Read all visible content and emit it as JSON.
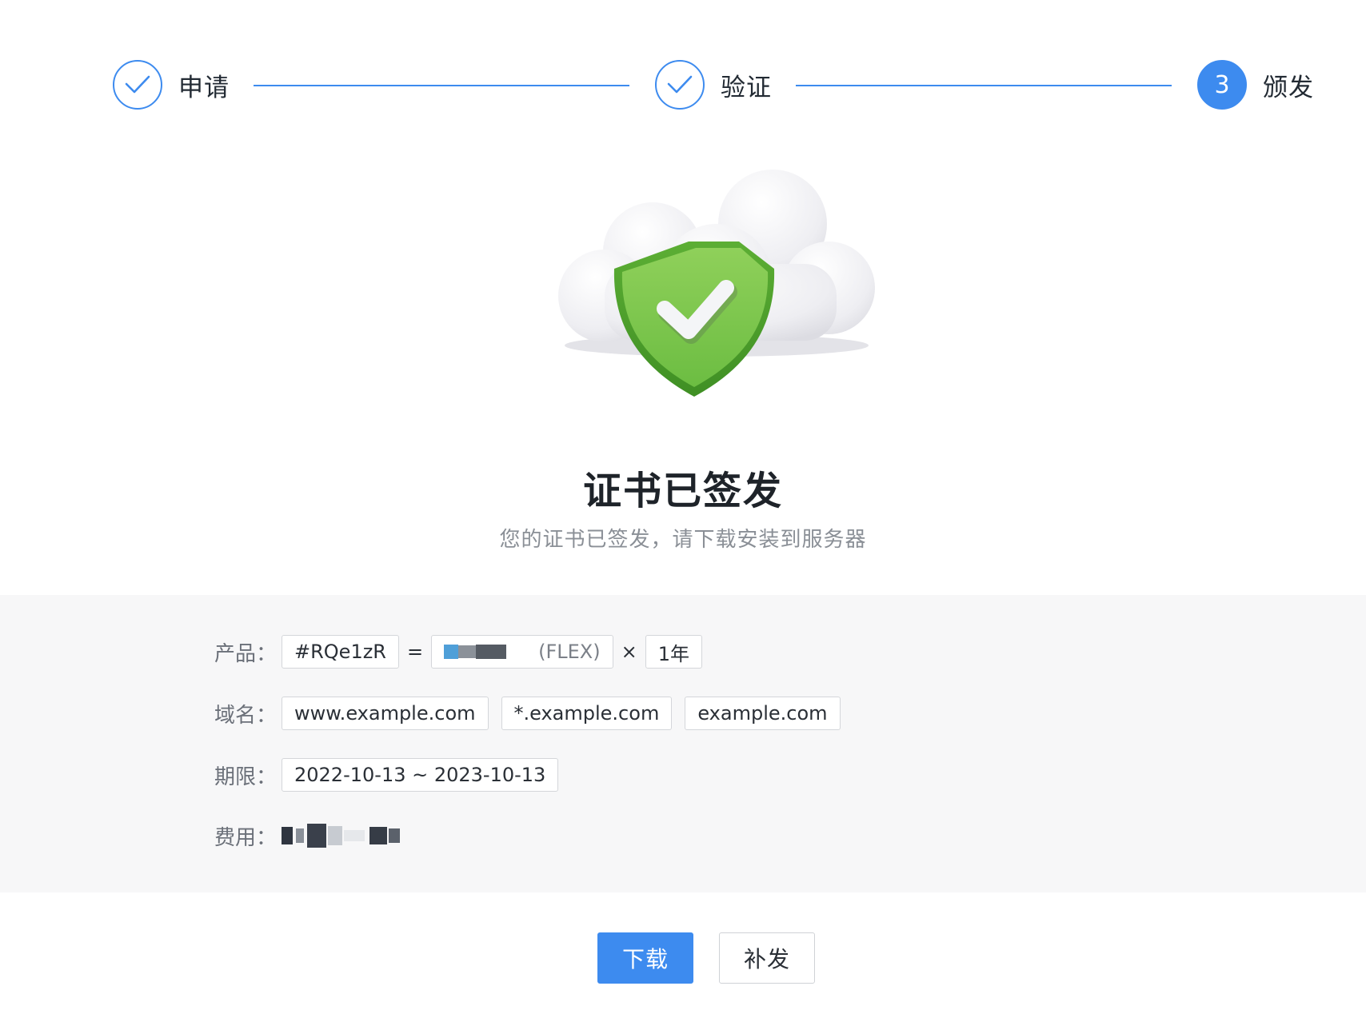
{
  "steps": [
    {
      "label": "申请",
      "state": "done",
      "icon": "check-icon"
    },
    {
      "label": "验证",
      "state": "done",
      "icon": "check-icon"
    },
    {
      "label": "颁发",
      "state": "active",
      "number": "3"
    }
  ],
  "illustration": {
    "icon": "cloud-shield-check-icon"
  },
  "result": {
    "title": "证书已签发",
    "subtitle": "您的证书已签发，请下载安装到服务器"
  },
  "details": {
    "product": {
      "label": "产品：",
      "order_id": "#RQe1zR",
      "equals": "=",
      "product_suffix": "(FLEX)",
      "times": "×",
      "duration": "1年"
    },
    "domains": {
      "label": "域名：",
      "items": [
        "www.example.com",
        "*.example.com",
        "example.com"
      ]
    },
    "period": {
      "label": "期限：",
      "value": "2022-10-13 ~ 2023-10-13"
    },
    "fee": {
      "label": "费用："
    }
  },
  "actions": {
    "download": "下载",
    "reissue": "补发"
  },
  "colors": {
    "accent": "#3d8bef",
    "panel": "#f7f7f8",
    "shield": "#6bbf3f"
  }
}
